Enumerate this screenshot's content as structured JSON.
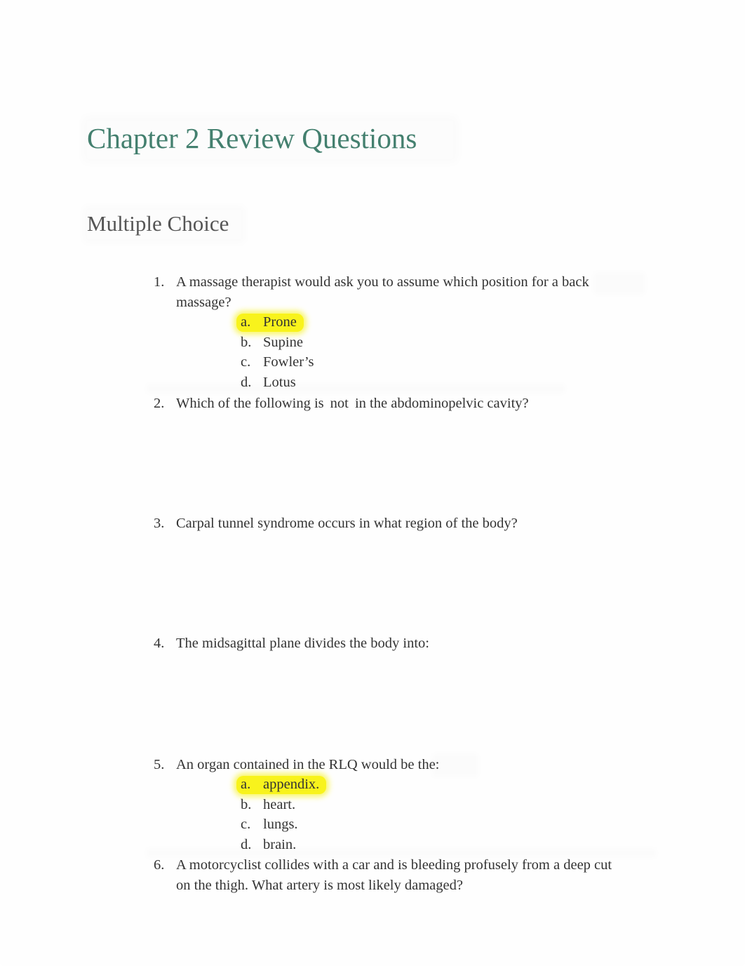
{
  "document": {
    "title": "Chapter 2 Review Questions",
    "section_heading": "Multiple Choice",
    "highlight_color": "#f8f31c",
    "title_color": "#44806f",
    "questions": [
      {
        "number": "1.",
        "text_line1": "A massage therapist would ask you to assume which position for a back",
        "text_line2": "massage?",
        "options": [
          {
            "letter": "a.",
            "text": "Prone",
            "highlighted": true
          },
          {
            "letter": "b.",
            "text": "Supine",
            "highlighted": false
          },
          {
            "letter": "c.",
            "text": "Fowler’s",
            "highlighted": false
          },
          {
            "letter": "d.",
            "text": "Lotus",
            "highlighted": false
          }
        ]
      },
      {
        "number": "2.",
        "text_before": "Which of the following is",
        "text_emphasis": "not",
        "text_after": "in the abdominopelvic cavity?"
      },
      {
        "number": "3.",
        "text": "Carpal tunnel syndrome occurs in what region of the body?"
      },
      {
        "number": "4.",
        "text": "The midsagittal plane divides the body into:"
      },
      {
        "number": "5.",
        "text": "An organ contained in the RLQ would be the:",
        "options": [
          {
            "letter": "a.",
            "text": "appendix.",
            "highlighted": true
          },
          {
            "letter": "b.",
            "text": "heart.",
            "highlighted": false
          },
          {
            "letter": "c.",
            "text": "lungs.",
            "highlighted": false
          },
          {
            "letter": "d.",
            "text": "brain.",
            "highlighted": false
          }
        ]
      },
      {
        "number": "6.",
        "text_line1": "A motorcyclist collides with a car and is bleeding profusely from a deep cut",
        "text_line2": "on the thigh. What artery is most likely damaged?"
      }
    ]
  }
}
